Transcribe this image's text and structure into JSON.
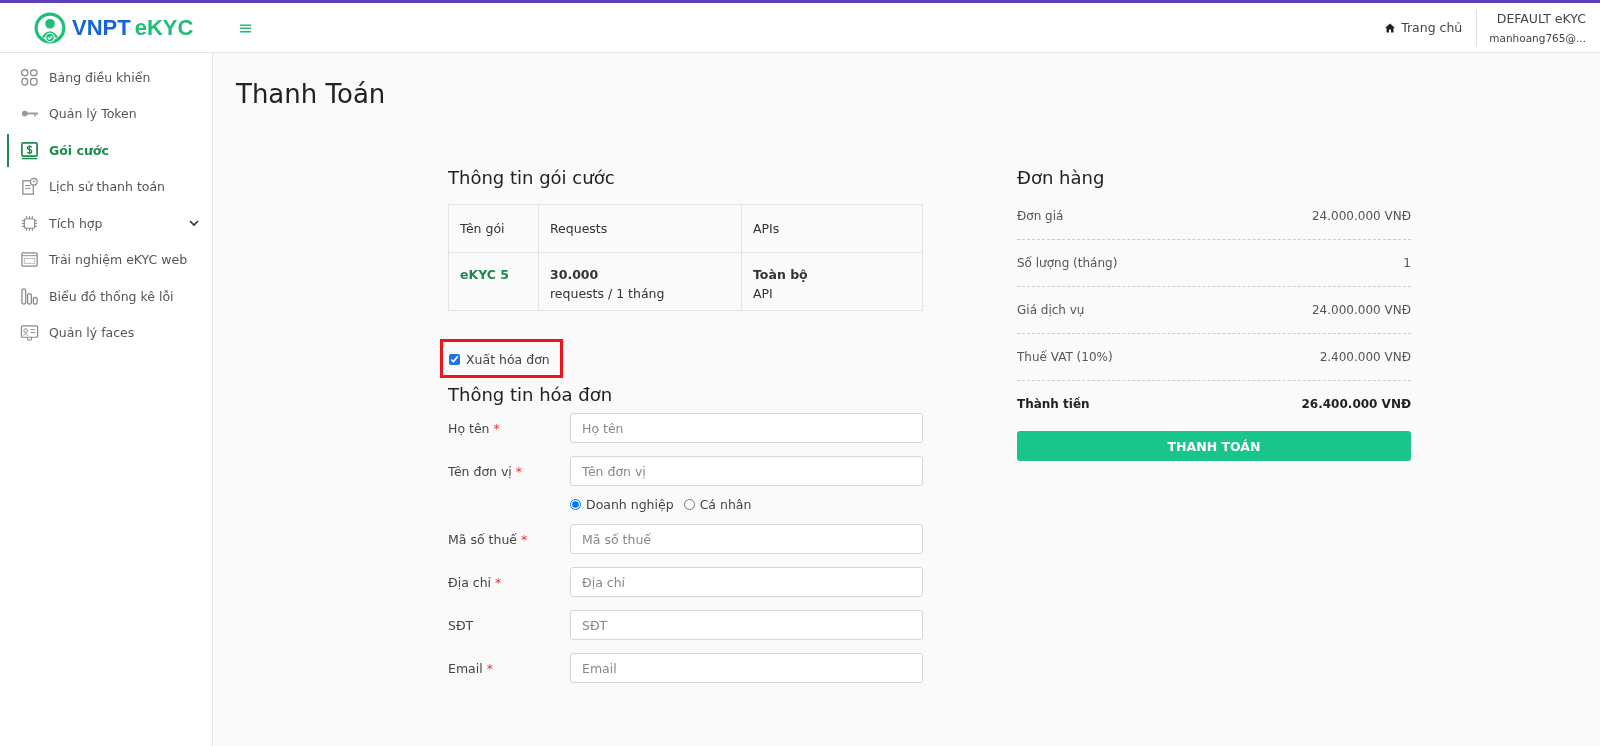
{
  "header": {
    "logo": {
      "brand": "VNPT",
      "product": "eKYC"
    },
    "menu_glyph": "≡",
    "home_link": "Trang chủ",
    "account": {
      "name": "DEFAULT eKYC",
      "email": "manhoang765@..."
    }
  },
  "sidebar": {
    "items": [
      {
        "label": "Bảng điều khiển",
        "selected": false,
        "expandable": false
      },
      {
        "label": "Quản lý Token",
        "selected": false,
        "expandable": false
      },
      {
        "label": "Gói cước",
        "selected": true,
        "expandable": false
      },
      {
        "label": "Lịch sử thanh toán",
        "selected": false,
        "expandable": false
      },
      {
        "label": "Tích hợp",
        "selected": false,
        "expandable": true
      },
      {
        "label": "Trải nghiệm eKYC web",
        "selected": false,
        "expandable": false
      },
      {
        "label": "Biểu đồ thống kê lỗi",
        "selected": false,
        "expandable": false
      },
      {
        "label": "Quản lý faces",
        "selected": false,
        "expandable": false
      }
    ]
  },
  "page_title": "Thanh Toán",
  "package": {
    "title": "Thông tin gói cước",
    "columns": [
      "Tên gói",
      "Requests",
      "APIs"
    ],
    "row": {
      "name": "eKYC 5",
      "requests": "30.000",
      "requests_unit": "requests / 1 tháng",
      "apis": "Toàn bộ",
      "apis_unit": "API"
    }
  },
  "invoice_checkbox": {
    "label": "Xuất hóa đơn",
    "checked": true
  },
  "invoice": {
    "title": "Thông tin hóa đơn",
    "fields": [
      {
        "kind": "input",
        "label": "Họ tên",
        "mark": "*",
        "placeholder": "Họ tên"
      },
      {
        "kind": "input",
        "label": "Tên đơn vị",
        "mark": "*",
        "placeholder": "Tên đơn vị"
      },
      {
        "kind": "radio",
        "options": [
          {
            "label": "Doanh nghiệp",
            "selected": true
          },
          {
            "label": "Cá nhân",
            "selected": false
          }
        ]
      },
      {
        "kind": "input",
        "label": "Mã số thuế",
        "mark": "*",
        "placeholder": "Mã số thuế"
      },
      {
        "kind": "input",
        "label": "Địa chỉ",
        "mark": "*",
        "placeholder": "Địa chỉ"
      },
      {
        "kind": "input",
        "label": "SĐT",
        "placeholder": "SĐT"
      },
      {
        "kind": "input",
        "label": "Email",
        "mark": "*",
        "placeholder": "Email"
      }
    ]
  },
  "order": {
    "title": "Đơn hàng",
    "rows": [
      {
        "label": "Đơn giá",
        "value": "24.000.000 VNĐ",
        "total": false
      },
      {
        "label": "Số lượng (tháng)",
        "value": "1",
        "total": false
      },
      {
        "label": "Giá dịch vụ",
        "value": "24.000.000 VNĐ",
        "total": false
      },
      {
        "label": "Thuế VAT (10%)",
        "value": "2.400.000 VNĐ",
        "total": false
      },
      {
        "label": "Thành tiền",
        "value": "26.400.000 VNĐ",
        "total": true
      }
    ],
    "button": "THANH TOÁN"
  }
}
